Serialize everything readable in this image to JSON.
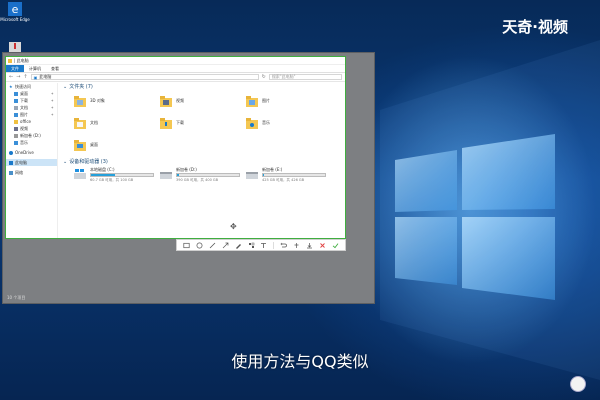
{
  "desktop": {
    "icons": [
      {
        "label": "Microsoft Edge"
      },
      {
        "label": ""
      }
    ]
  },
  "watermark": "天奇·视频",
  "caption": "使用方法与QQ类似",
  "explorer": {
    "title": "| 此电脑",
    "ribbon_tabs": [
      "文件",
      "计算机",
      "查看"
    ],
    "address": "此电脑",
    "search_placeholder": "搜索\"此电脑\"",
    "nav": {
      "quick_access": "快速访问",
      "items": [
        {
          "label": "桌面",
          "pinned": true
        },
        {
          "label": "下载",
          "pinned": true
        },
        {
          "label": "文档",
          "pinned": true
        },
        {
          "label": "图片",
          "pinned": true
        },
        {
          "label": "office",
          "pinned": false
        },
        {
          "label": "视频",
          "pinned": false
        },
        {
          "label": "新加卷 (D:)",
          "pinned": false
        },
        {
          "label": "音乐",
          "pinned": false
        }
      ],
      "onedrive": "OneDrive",
      "this_pc": "此电脑",
      "network": "网络"
    },
    "folders_header": "文件夹 (7)",
    "folders": [
      {
        "label": "3D 对象"
      },
      {
        "label": "视频"
      },
      {
        "label": "图片"
      },
      {
        "label": "文档"
      },
      {
        "label": "下载"
      },
      {
        "label": "音乐"
      },
      {
        "label": "桌面"
      }
    ],
    "drives_header": "设备和驱动器 (3)",
    "drives": [
      {
        "name": "本地磁盘 (C:)",
        "free": "60.7 GB 可用，共 100 GB",
        "used_fraction": 0.39,
        "color": "#26a0da"
      },
      {
        "name": "新加卷 (D:)",
        "free": "390 GB 可用，共 400 GB",
        "used_fraction": 0.03,
        "color": "#26a0da"
      },
      {
        "name": "新加卷 (E:)",
        "free": "425 GB 可用，共 426 GB",
        "used_fraction": 0.01,
        "color": "#26a0da"
      }
    ],
    "status": "10 个项目"
  },
  "snip_toolbar": {
    "tools": [
      "rectangle-icon",
      "ellipse-icon",
      "pen-icon",
      "arrow-icon",
      "brush-icon",
      "mosaic-icon",
      "text-icon",
      "undo-icon",
      "pin-icon",
      "save-icon",
      "cancel-icon",
      "confirm-icon"
    ]
  },
  "colors": {
    "selection_border": "#3fae3f",
    "accent": "#1979ca",
    "confirm": "#3fae3f",
    "cancel": "#e04040"
  }
}
